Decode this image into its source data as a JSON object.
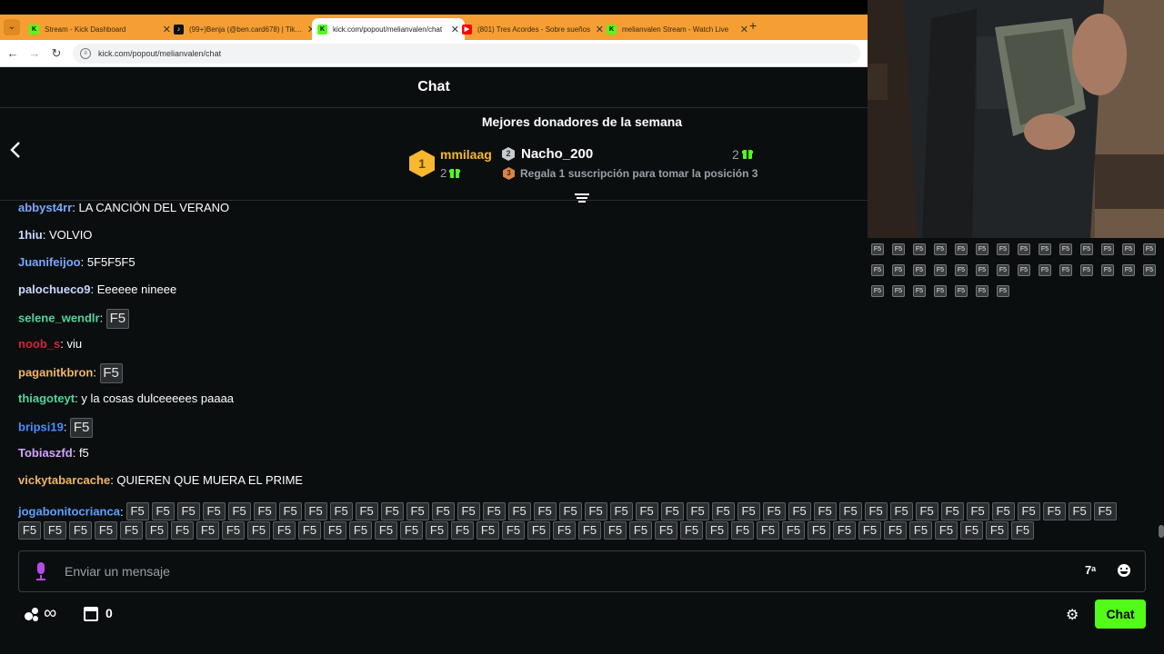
{
  "browser": {
    "tabs": [
      {
        "label": "Stream - Kick Dashboard",
        "favicon": "kick-icon",
        "active": false
      },
      {
        "label": "(99+)Benja (@ben.card678) | TikTok",
        "favicon": "tiktok-icon",
        "active": false
      },
      {
        "label": "kick.com/popout/melianvalen/chat",
        "favicon": "kick-icon",
        "active": true
      },
      {
        "label": "(801) Tres Acordes - Sobre sueños",
        "favicon": "youtube-icon",
        "active": false
      },
      {
        "label": "melianvalen Stream - Watch Live",
        "favicon": "kick-icon",
        "active": false
      }
    ],
    "url": "kick.com/popout/melianvalen/chat"
  },
  "chat": {
    "title": "Chat",
    "leaderboard": {
      "title": "Mejores donadores de la semana",
      "first": {
        "rank": "1",
        "name": "mmilaag",
        "count": "2"
      },
      "second": {
        "rank": "2",
        "name": "Nacho_200",
        "count": "2"
      },
      "third": {
        "rank": "3",
        "text": "Regala 1 suscripción para tomar la posición 3"
      }
    },
    "messages": [
      {
        "user": "abbyst4rr",
        "color": "#7aa7ff",
        "text": "LA CANCIÓN DEL VERANO"
      },
      {
        "user": "1hiu",
        "color": "#c8d8ff",
        "text": "VOLVIO"
      },
      {
        "user": "Juanifeijoo",
        "color": "#7aa7ff",
        "text": "5F5F5F5"
      },
      {
        "user": "palochueco9",
        "color": "#c8d8ff",
        "text": "Eeeeee nineee"
      },
      {
        "user": "selene_wendlr",
        "color": "#52d39a",
        "emote": "F5"
      },
      {
        "user": "noob_s",
        "color": "#d1243b",
        "text": "viu"
      },
      {
        "user": "paganitkbron",
        "color": "#f0b563",
        "emote": "F5"
      },
      {
        "user": "thiagoteyt",
        "color": "#52d39a",
        "text": "y la cosas dulceeeees paaaa"
      },
      {
        "user": "bripsi19",
        "color": "#4a8cff",
        "emote": "F5"
      },
      {
        "user": "Tobiaszfd",
        "color": "#d5a3ff",
        "text": "f5"
      },
      {
        "user": "vickytabarcache",
        "color": "#f0b563",
        "text": "QUIEREN QUE MUERA EL PRIME"
      }
    ],
    "wall": {
      "user": "jogabonitocrianca",
      "emote": "F5",
      "count": 79
    },
    "composer": {
      "placeholder": "Enviar un mensaje"
    },
    "footer": {
      "points": "∞",
      "store_count": "0",
      "chat_button": "Chat"
    }
  },
  "webcam": {
    "emote": "F5",
    "count": 35
  },
  "colors": {
    "accent": "#53fc18",
    "tabbar": "#f59e33",
    "background": "#0b0e0f"
  }
}
